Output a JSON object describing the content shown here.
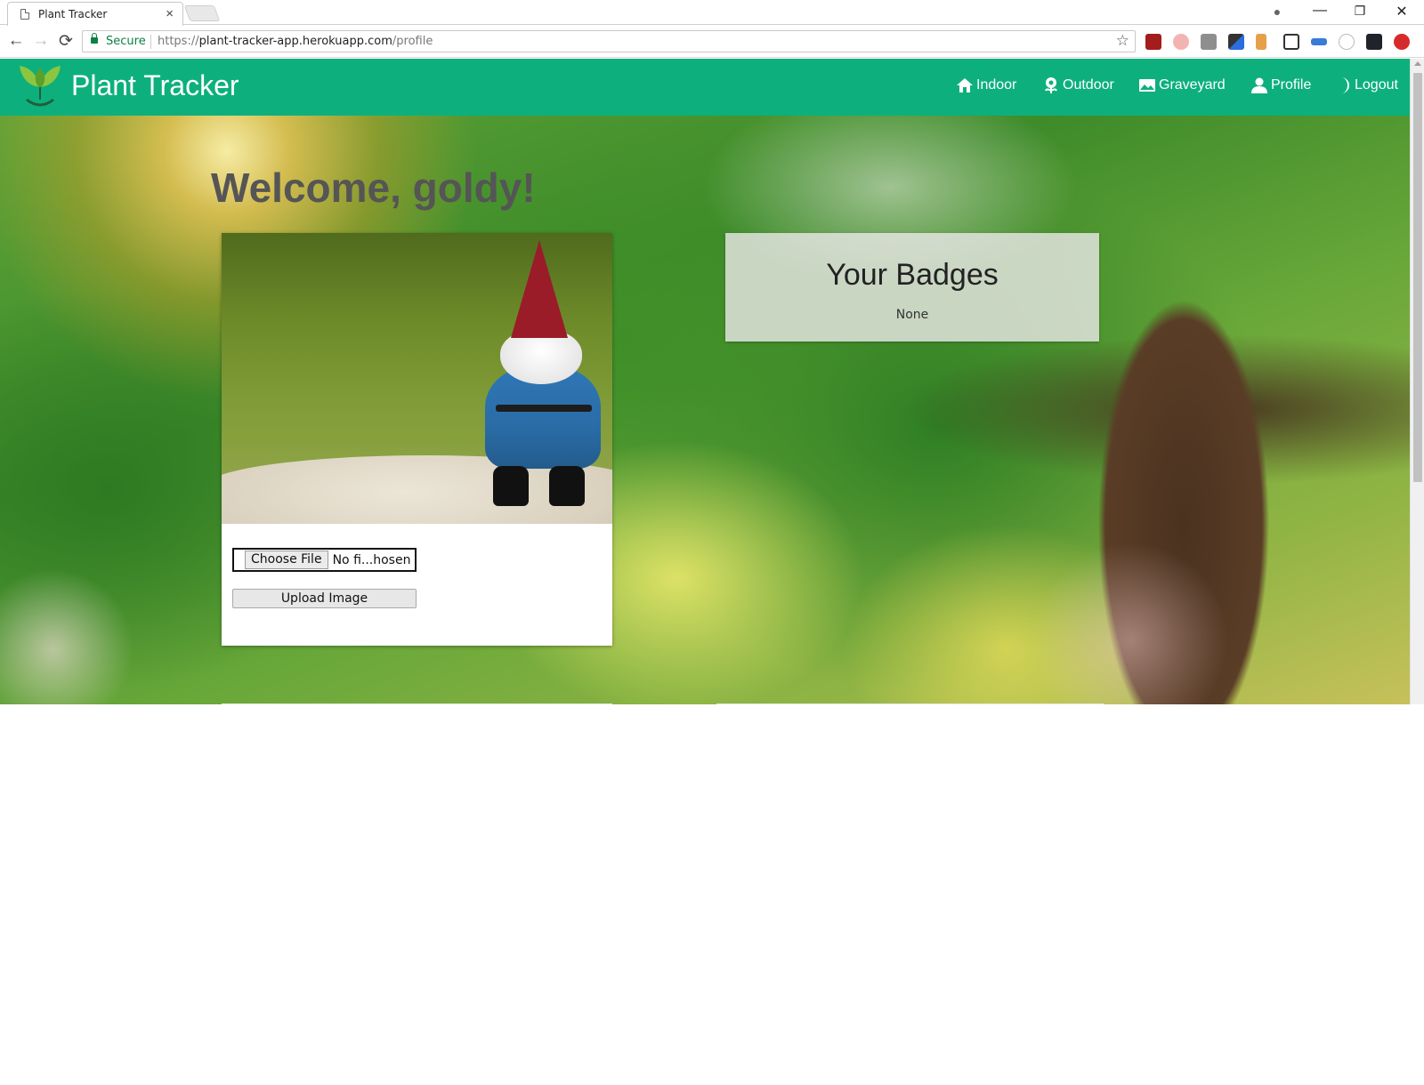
{
  "browser": {
    "tab_title": "Plant Tracker",
    "tab_close": "×",
    "secure_label": "Secure",
    "url_scheme": "https://",
    "url_host": "plant-tracker-app.herokuapp.com",
    "url_path": "/profile",
    "nav": {
      "back": "←",
      "forward": "→",
      "reload": "⟳"
    },
    "window_controls": {
      "account": "●",
      "minimize": "—",
      "restore": "❐",
      "close": "✕"
    },
    "bookmark_star": "☆",
    "extension_icons": [
      "ublock-icon",
      "lastpass-icon",
      "notes-icon",
      "colorpicker-icon",
      "paint-icon",
      "screenshot-icon",
      "arrows-icon",
      "ghost-icon",
      "react-devtools-icon",
      "update-icon"
    ]
  },
  "app": {
    "brand": "Plant Tracker",
    "nav": [
      {
        "label": "Indoor",
        "icon": "home-icon"
      },
      {
        "label": "Outdoor",
        "icon": "flower-icon"
      },
      {
        "label": "Graveyard",
        "icon": "image-icon"
      },
      {
        "label": "Profile",
        "icon": "person-icon"
      },
      {
        "label": "Logout",
        "icon": "moon-icon"
      }
    ],
    "colors": {
      "nav_bg": "#0db07c",
      "welcome_text": "#555555"
    }
  },
  "profile": {
    "welcome": "Welcome, goldy!",
    "photo_alt": "garden gnome photo",
    "file_button": "Choose File",
    "file_name": "No fi...hosen",
    "upload_button": "Upload Image"
  },
  "badges": {
    "title": "Your Badges",
    "empty_text": "None"
  }
}
